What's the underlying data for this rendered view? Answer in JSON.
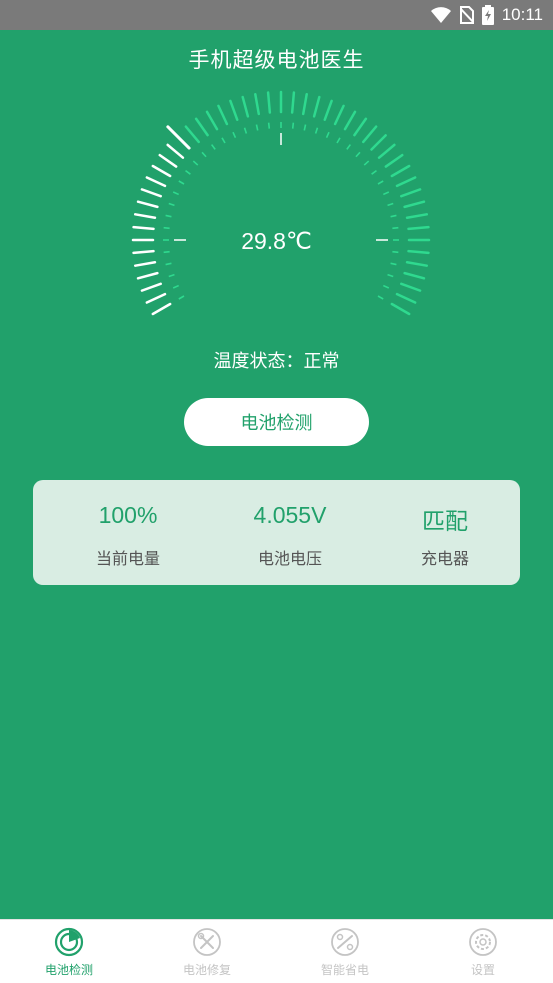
{
  "status_bar": {
    "time": "10:11",
    "icons": [
      "wifi-icon",
      "no-sim-icon",
      "battery-charging-icon"
    ]
  },
  "app_title": "手机超级电池医生",
  "gauge": {
    "temperature": "29.8℃",
    "level": 0.32
  },
  "temperature_status": "温度状态：正常",
  "detect_button": "电池检测",
  "info": {
    "battery_level": {
      "value": "100%",
      "label": "当前电量"
    },
    "voltage": {
      "value": "4.055V",
      "label": "电池电压"
    },
    "charger": {
      "value": "匹配",
      "label": "充电器"
    }
  },
  "nav": {
    "items": [
      {
        "label": "电池检测",
        "icon": "battery-detect-icon",
        "active": true
      },
      {
        "label": "电池修复",
        "icon": "battery-repair-icon",
        "active": false
      },
      {
        "label": "智能省电",
        "icon": "smart-save-icon",
        "active": false
      },
      {
        "label": "设置",
        "icon": "settings-icon",
        "active": false
      }
    ]
  },
  "colors": {
    "primary": "#21a16b",
    "tick_active": "#ffffff",
    "tick_inactive": "#2fd98f",
    "card": "#d9ede3",
    "nav_inactive": "#c4c4c4"
  }
}
